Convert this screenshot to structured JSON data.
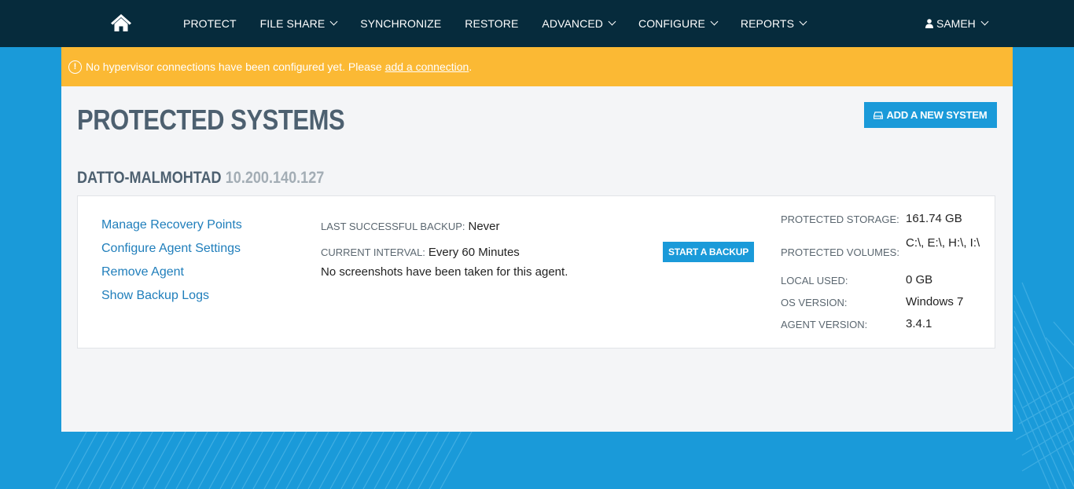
{
  "nav": {
    "home_icon": "home-icon",
    "items": [
      {
        "label": "PROTECT",
        "dropdown": false
      },
      {
        "label": "FILE SHARE",
        "dropdown": true
      },
      {
        "label": "SYNCHRONIZE",
        "dropdown": false
      },
      {
        "label": "RESTORE",
        "dropdown": false
      },
      {
        "label": "ADVANCED",
        "dropdown": true
      },
      {
        "label": "CONFIGURE",
        "dropdown": true
      },
      {
        "label": "REPORTS",
        "dropdown": true
      }
    ],
    "user": {
      "label": "SAMEH",
      "icon": "user-icon"
    }
  },
  "alert": {
    "icon": "exclamation-circle-icon",
    "text": "No hypervisor connections have been configured yet. Please",
    "link": "add a connection",
    "suffix": "."
  },
  "page": {
    "title": "PROTECTED SYSTEMS",
    "add_button": "ADD A NEW SYSTEM"
  },
  "system": {
    "name": "DATTO-MALMOHTAD",
    "ip": "10.200.140.127",
    "links": [
      "Manage Recovery Points",
      "Configure Agent Settings",
      "Remove Agent",
      "Show Backup Logs"
    ],
    "last_backup_label": "LAST SUCCESSFUL BACKUP:",
    "last_backup_value": "Never",
    "interval_label": "CURRENT INTERVAL:",
    "interval_value": "Every 60 Minutes",
    "screenshot_note": "No screenshots have been taken for this agent.",
    "start_button": "START A BACKUP",
    "details": [
      {
        "label": "PROTECTED STORAGE:",
        "value": "161.74 GB"
      },
      {
        "label": "PROTECTED VOLUMES:",
        "value": "C:\\, E:\\, H:\\, I:\\"
      },
      {
        "label": "LOCAL USED:",
        "value": "0 GB"
      },
      {
        "label": "OS VERSION:",
        "value": "Windows 7"
      },
      {
        "label": "AGENT VERSION:",
        "value": "3.4.1"
      }
    ]
  },
  "colors": {
    "navbar": "#062b3c",
    "background": "#1a9ad9",
    "alert": "#fbb934",
    "panel": "#f4f5f7",
    "link": "#1f7ebb",
    "title": "#4d6070"
  }
}
